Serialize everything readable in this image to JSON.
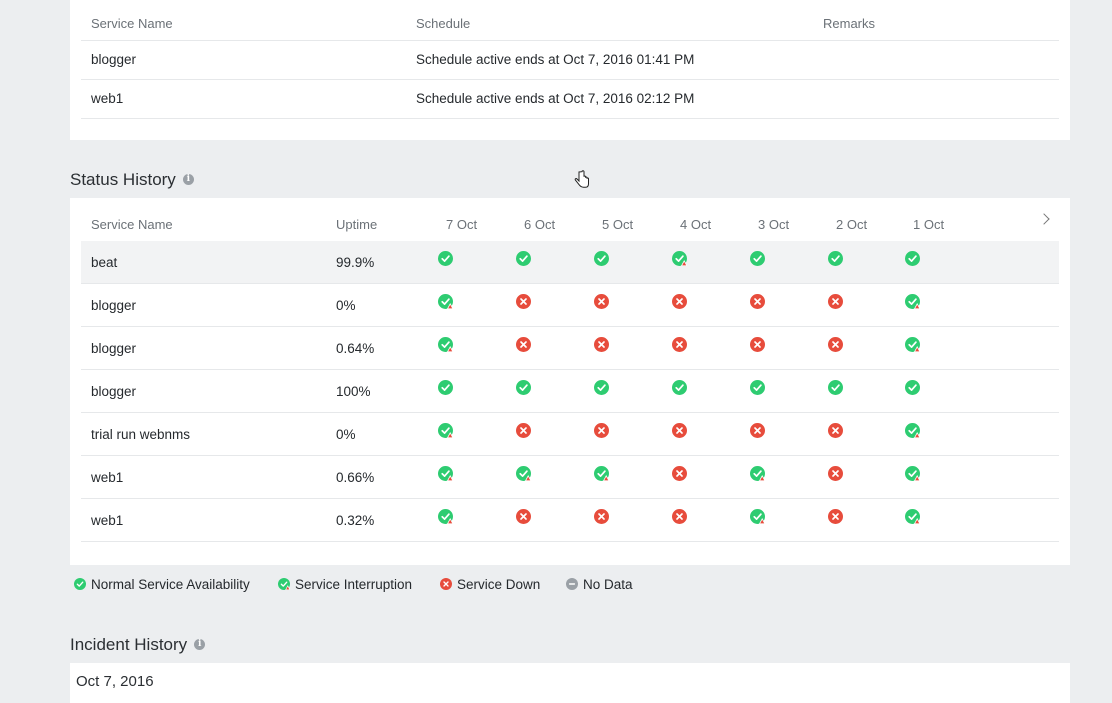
{
  "schedule": {
    "headers": {
      "service": "Service Name",
      "schedule": "Schedule",
      "remarks": "Remarks"
    },
    "rows": [
      {
        "service": "blogger",
        "schedule": "Schedule active ends at Oct 7, 2016 01:41 PM",
        "remarks": ""
      },
      {
        "service": "web1",
        "schedule": "Schedule active ends at Oct 7, 2016 02:12 PM",
        "remarks": ""
      }
    ]
  },
  "status_history": {
    "title": "Status History",
    "headers": {
      "service": "Service Name",
      "uptime": "Uptime"
    },
    "days": [
      "7 Oct",
      "6 Oct",
      "5 Oct",
      "4 Oct",
      "3 Oct",
      "2 Oct",
      "1 Oct"
    ],
    "rows": [
      {
        "service": "beat",
        "uptime": "99.9%",
        "status": [
          "ok",
          "ok",
          "ok",
          "int",
          "ok",
          "ok",
          "ok"
        ]
      },
      {
        "service": "blogger",
        "uptime": "0%",
        "status": [
          "int",
          "down",
          "down",
          "down",
          "down",
          "down",
          "int"
        ]
      },
      {
        "service": "blogger",
        "uptime": "0.64%",
        "status": [
          "int",
          "down",
          "down",
          "down",
          "down",
          "down",
          "int"
        ]
      },
      {
        "service": "blogger",
        "uptime": "100%",
        "status": [
          "ok",
          "ok",
          "ok",
          "ok",
          "ok",
          "ok",
          "ok"
        ]
      },
      {
        "service": "trial run webnms",
        "uptime": "0%",
        "status": [
          "int",
          "down",
          "down",
          "down",
          "down",
          "down",
          "int"
        ]
      },
      {
        "service": "web1",
        "uptime": "0.66%",
        "status": [
          "int",
          "int",
          "int",
          "down",
          "int",
          "down",
          "int"
        ]
      },
      {
        "service": "web1",
        "uptime": "0.32%",
        "status": [
          "int",
          "down",
          "down",
          "down",
          "int",
          "down",
          "int"
        ]
      }
    ]
  },
  "legend": {
    "normal": "Normal Service Availability",
    "interruption": "Service Interruption",
    "down": "Service Down",
    "nodata": "No Data"
  },
  "incident_history": {
    "title": "Incident History",
    "date": "Oct 7, 2016"
  },
  "colors": {
    "ok": "#2ecc71",
    "down": "#e74c3c",
    "nodata": "#9aa0a6",
    "highlight_row": "#f2f3f4"
  }
}
